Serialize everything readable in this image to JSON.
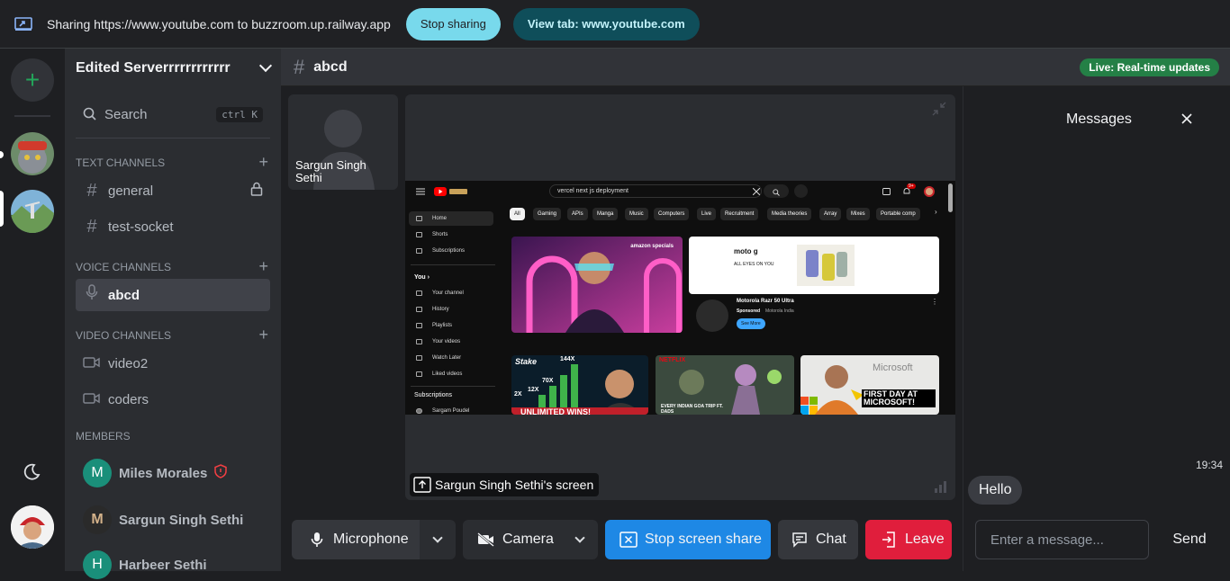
{
  "sharebar": {
    "text": "Sharing https://www.youtube.com to buzzroom.up.railway.app",
    "stop_label": "Stop sharing",
    "view_label": "View tab: www.youtube.com"
  },
  "server": {
    "name": "Edited Serverrrrrrrrrrrr",
    "search_label": "Search",
    "search_shortcut": "ctrl K",
    "text_channels_header": "TEXT CHANNELS",
    "text_channels": [
      "general",
      "test-socket"
    ],
    "voice_channels_header": "VOICE CHANNELS",
    "voice_channels": [
      "abcd"
    ],
    "video_channels_header": "VIDEO CHANNELS",
    "video_channels": [
      "video2",
      "coders"
    ],
    "members_header": "MEMBERS",
    "members": [
      {
        "name": "Miles Morales",
        "initial": "M",
        "color": "#1a8f7a"
      },
      {
        "name": "Sargun Singh Sethi",
        "initial": "M",
        "color": "#2a2a2a"
      },
      {
        "name": "Harbeer Sethi",
        "initial": "H",
        "color": "#1a8f7a"
      }
    ]
  },
  "header": {
    "channel": "abcd",
    "live_badge": "Live: Real-time updates"
  },
  "stage": {
    "participant": "Sargun Singh Sethi",
    "screen_label": "Sargun Singh Sethi's screen"
  },
  "youtube": {
    "search_query": "vercel next js deployment",
    "chips": [
      "All",
      "Gaming",
      "APIs",
      "Manga",
      "Music",
      "Computers",
      "Live",
      "Recruitment",
      "Media theories",
      "Array",
      "Mixes",
      "Portable comp"
    ],
    "nav_main": [
      "Home",
      "Shorts",
      "Subscriptions"
    ],
    "you_header": "You",
    "nav_you": [
      "Your channel",
      "History",
      "Playlists",
      "Your videos",
      "Watch Later",
      "Liked videos"
    ],
    "subs_header": "Subscriptions",
    "subs": [
      "Sargam Poudel"
    ],
    "ad_title": "Motorola Razr 50 Ultra",
    "ad_sponsor": "Sponsored",
    "ad_brand": "Motorola India",
    "ad_button": "See More",
    "ad_banner_brand": "moto g",
    "ad_banner_tag": "ALL EYES ON YOU",
    "thumb1_text": "UNLIMITED WINS!",
    "thumb1_brand": "Stake",
    "thumb1_multipliers": [
      "144X",
      "70X",
      "12X",
      "2X"
    ],
    "thumb2_brand": "NETFLIX",
    "thumb2_text": "EVERY INDIAN GOA TRIP FT. DADS",
    "thumb3_text": "FIRST DAY AT MICROSOFT!",
    "thumb3_brand": "Microsoft",
    "promo_brand": "amazon specials",
    "notif_count": "9+"
  },
  "controls": {
    "microphone": "Microphone",
    "camera": "Camera",
    "stop_share": "Stop screen share",
    "chat": "Chat",
    "leave": "Leave"
  },
  "chat": {
    "title": "Messages",
    "time": "19:34",
    "message": "Hello",
    "placeholder": "Enter a message...",
    "send": "Send"
  },
  "colors": {
    "accent": "#248046",
    "share_blue": "#1e88e5",
    "leave_red": "#e01e3c",
    "stop_pill": "#78d9ec"
  }
}
